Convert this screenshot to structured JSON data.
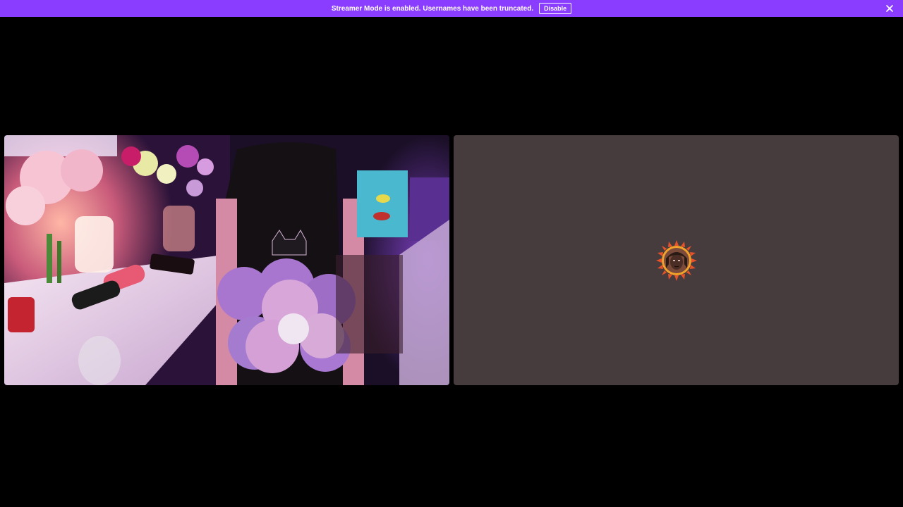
{
  "banner": {
    "message": "Streamer Mode is enabled. Usernames have been truncated.",
    "disable_label": "Disable",
    "close_icon": "close-icon",
    "color": "#8b3dff"
  },
  "stage": {
    "background": "#000000",
    "tiles": [
      {
        "kind": "video",
        "subject": "camera-feed"
      },
      {
        "kind": "avatar",
        "background": "#473c3d",
        "avatar_icon": "user-avatar"
      }
    ]
  }
}
